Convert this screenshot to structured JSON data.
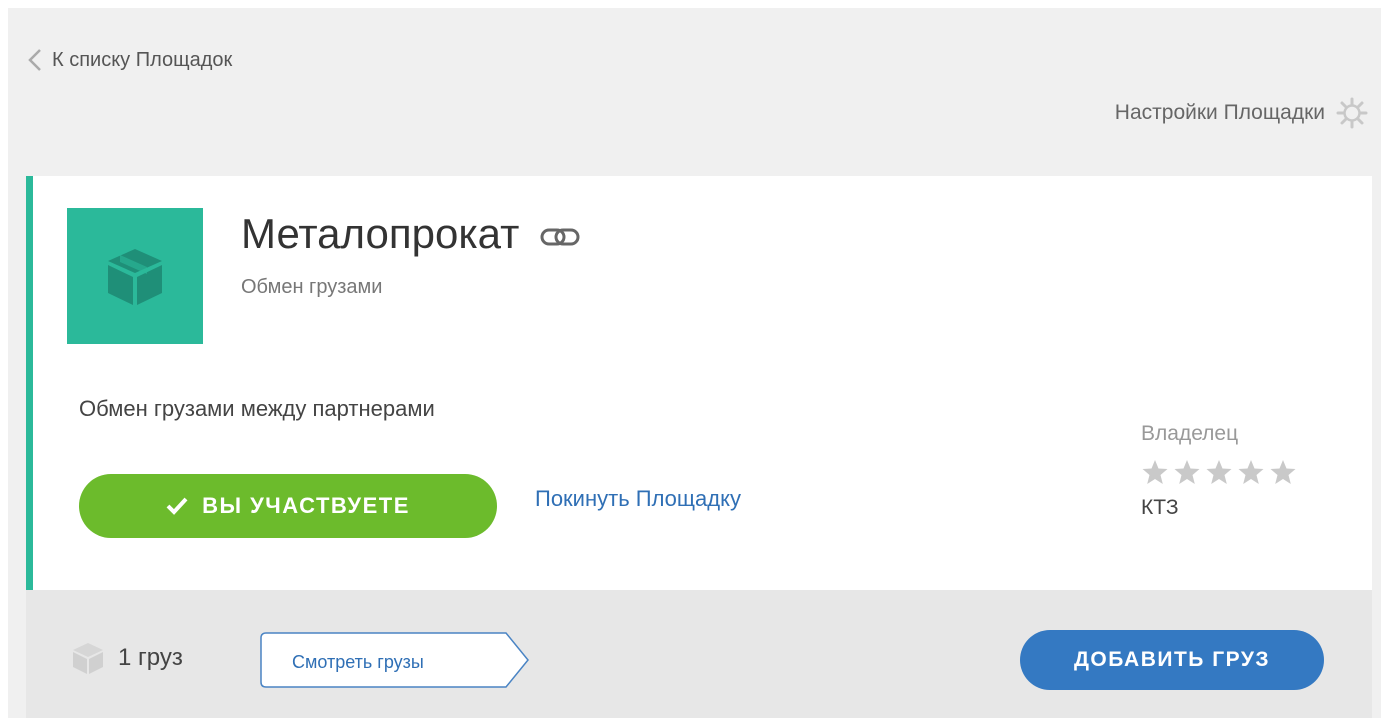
{
  "nav": {
    "back_label": "К списку Площадок",
    "settings_label": "Настройки Площадки"
  },
  "platform": {
    "title": "Металопрокат",
    "subtitle": "Обмен грузами",
    "description": "Обмен грузами между партнерами",
    "participate_label": "ВЫ УЧАСТВУЕТЕ",
    "leave_label": "Покинуть Площадку",
    "accent_color": "#2bb99a"
  },
  "owner": {
    "label": "Владелец",
    "name": "КТЗ",
    "rating": 0,
    "rating_max": 5
  },
  "footer": {
    "cargo_count": "1 груз",
    "view_label": "Смотреть грузы",
    "add_label": "ДОБАВИТЬ ГРУЗ"
  }
}
